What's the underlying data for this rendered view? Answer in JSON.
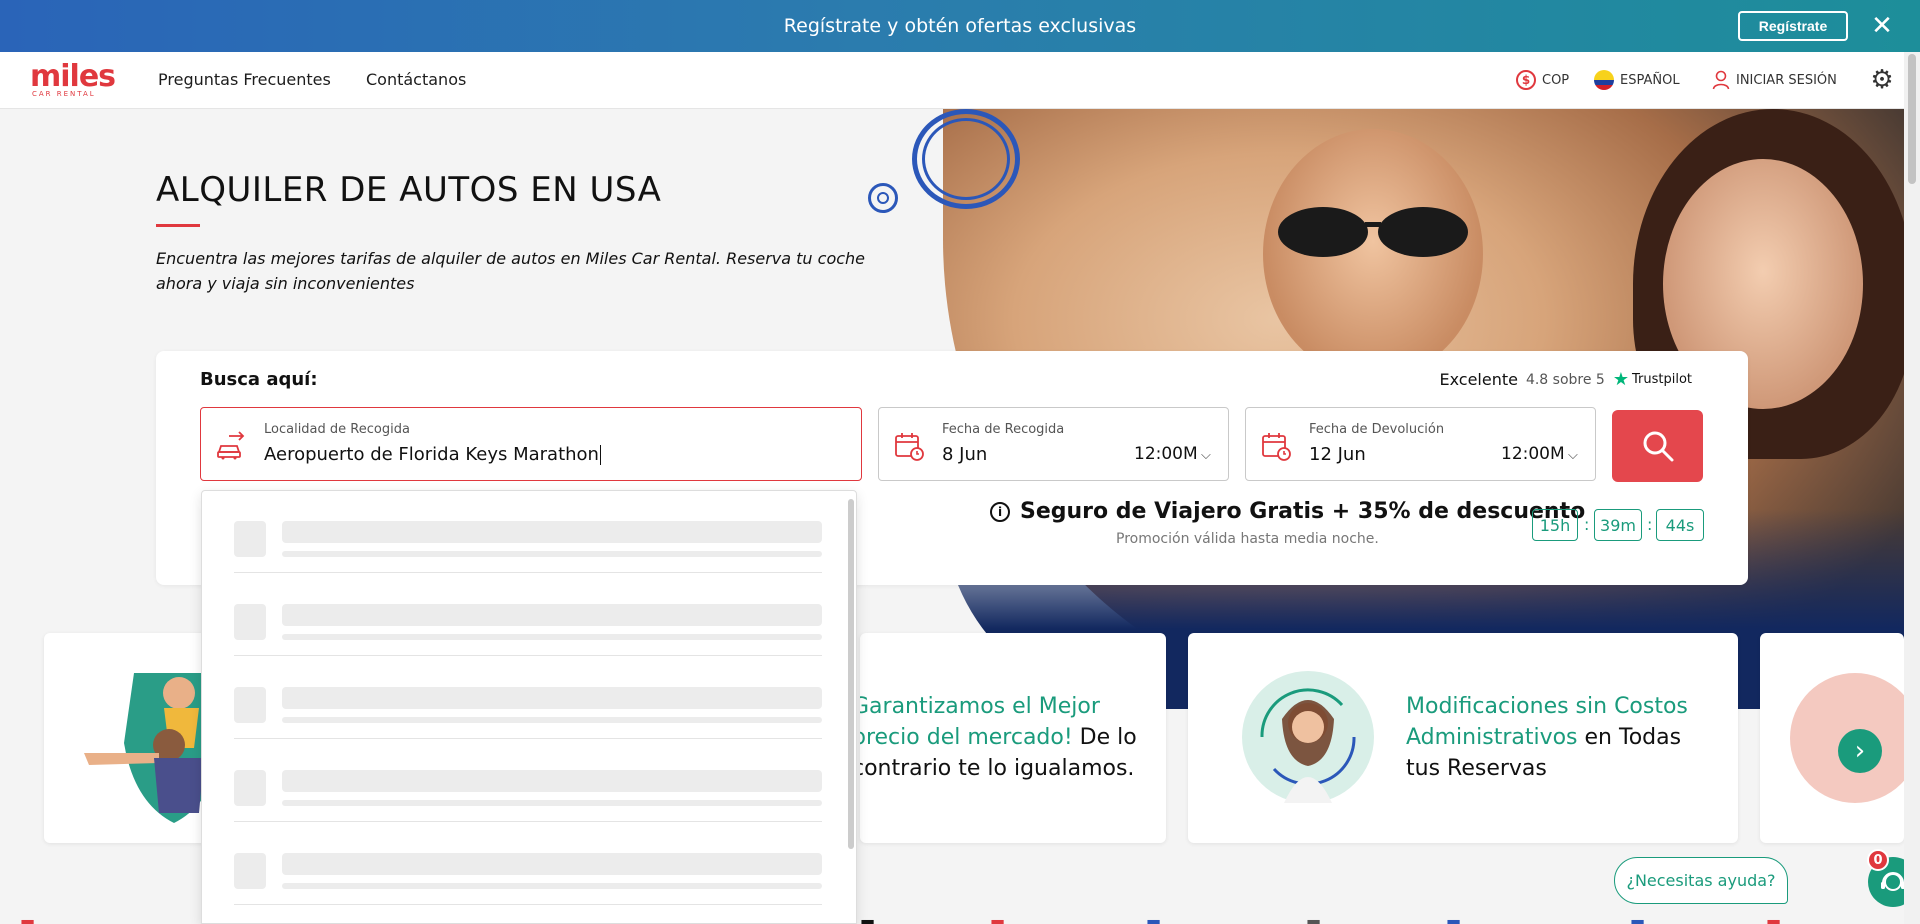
{
  "promo_bar": {
    "text": "Regístrate y obtén ofertas exclusivas",
    "button": "Regístrate",
    "close": "✕"
  },
  "header": {
    "logo_main": "miles",
    "logo_sub": "CAR RENTAL",
    "nav": [
      "Preguntas Frecuentes",
      "Contáctanos"
    ],
    "currency": "COP",
    "language": "ESPAÑOL",
    "login": "INICIAR SESIÓN"
  },
  "hero": {
    "title": "ALQUILER DE AUTOS EN USA",
    "subtitle": "Encuentra las mejores tarifas de alquiler de autos en Miles Car Rental. Reserva tu coche ahora y viaja sin inconvenientes"
  },
  "search": {
    "heading": "Busca aquí:",
    "trust_label": "Excelente",
    "trust_rating": "4.8 sobre 5",
    "trust_brand": "Trustpilot",
    "pickup_location": {
      "label": "Localidad de Recogida",
      "value": "Aeropuerto de Florida Keys Marathon"
    },
    "pickup_date": {
      "label": "Fecha de Recogida",
      "date": "8 Jun",
      "time": "12:00M"
    },
    "return_date": {
      "label": "Fecha de Devolución",
      "date": "12 Jun",
      "time": "12:00M"
    },
    "promo_text": "Seguro de Viajero Gratis + 35% de descuento",
    "promo_note": "Promoción válida hasta media noche.",
    "timer": {
      "h": "15h",
      "m": "39m",
      "s": "44s"
    }
  },
  "features": [
    {
      "highlight": "Garantizamos el Mejor precio del mercado!",
      "rest": " De lo contrario te lo igualamos."
    },
    {
      "highlight": "Modificaciones sin Costos Administrativos",
      "rest": " en Todas tus Reservas"
    }
  ],
  "help": {
    "label": "¿Necesitas ayuda?",
    "badge": "0"
  },
  "colors": {
    "accent_red": "#e0383e",
    "accent_green": "#1a9b7c",
    "brand_blue": "#2b57b9"
  }
}
